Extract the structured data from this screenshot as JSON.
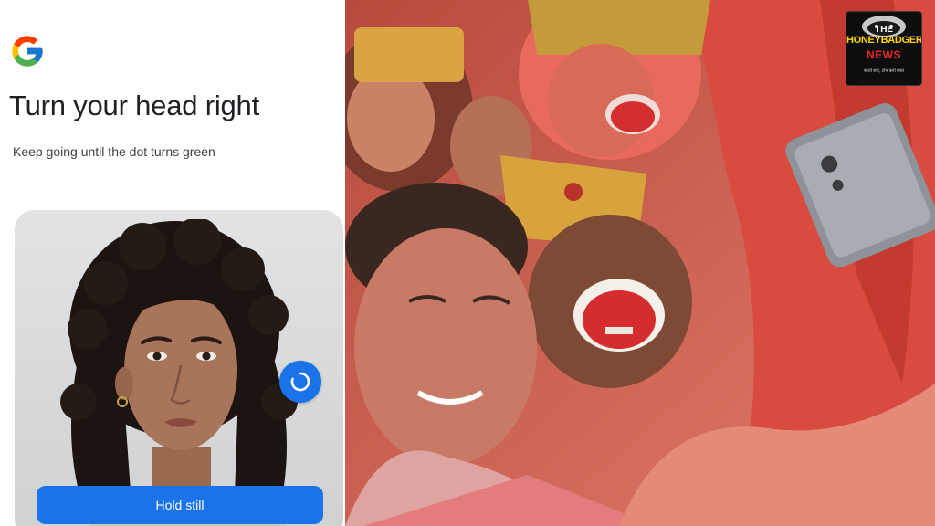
{
  "verification": {
    "brand_icon": "google-g-logo-icon",
    "title": "Turn your head right",
    "subtitle": "Keep going until the dot turns green",
    "status_icon": "loading-spinner-icon",
    "button_label": "Hold still",
    "colors": {
      "accent": "#1a73e8",
      "title_text": "#202124",
      "card_bg": "#dcdedf"
    }
  },
  "photo": {
    "description_icon": "selfie-photo",
    "badge": {
      "line1": "THE",
      "line2": "HONEYBADGER",
      "line3": "NEWS",
      "tagline": "बोलो सच, टोन करो मस्त"
    }
  }
}
